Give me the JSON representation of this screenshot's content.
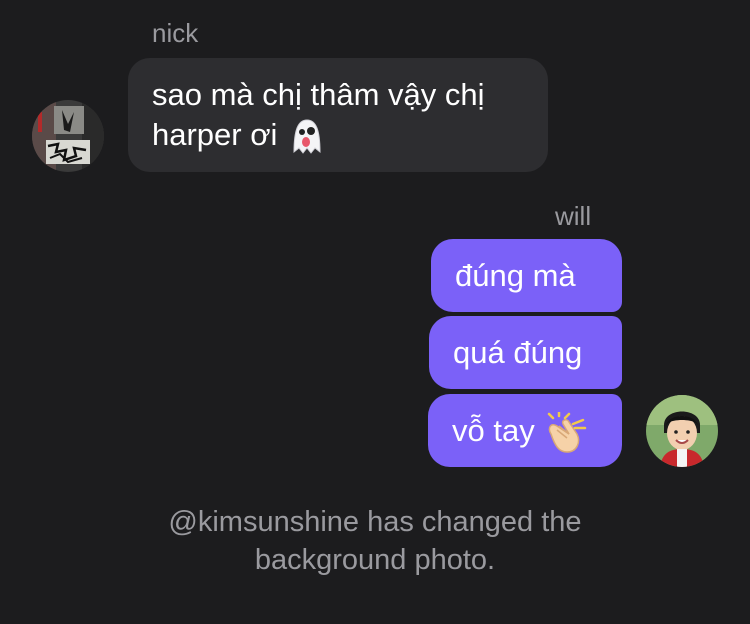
{
  "messages": {
    "incoming": {
      "sender": "nick",
      "text_line1": "sao mà chị thâm vậy chị",
      "text_line2": "harper ơi",
      "emoji_icon": "ghost-emoji-icon"
    },
    "outgoing": {
      "sender": "will",
      "bubbles": [
        {
          "text": "đúng mà"
        },
        {
          "text": "quá đúng"
        },
        {
          "text": "vỗ tay",
          "emoji_icon": "clapping-hands-emoji-icon"
        }
      ]
    }
  },
  "system": {
    "line1": "@kimsunshine has changed the",
    "line2": "background photo."
  },
  "colors": {
    "background": "#1c1c1e",
    "incoming_bubble": "#2d2d30",
    "outgoing_bubble": "#7b61f8",
    "secondary_text": "#9a9a9f"
  }
}
